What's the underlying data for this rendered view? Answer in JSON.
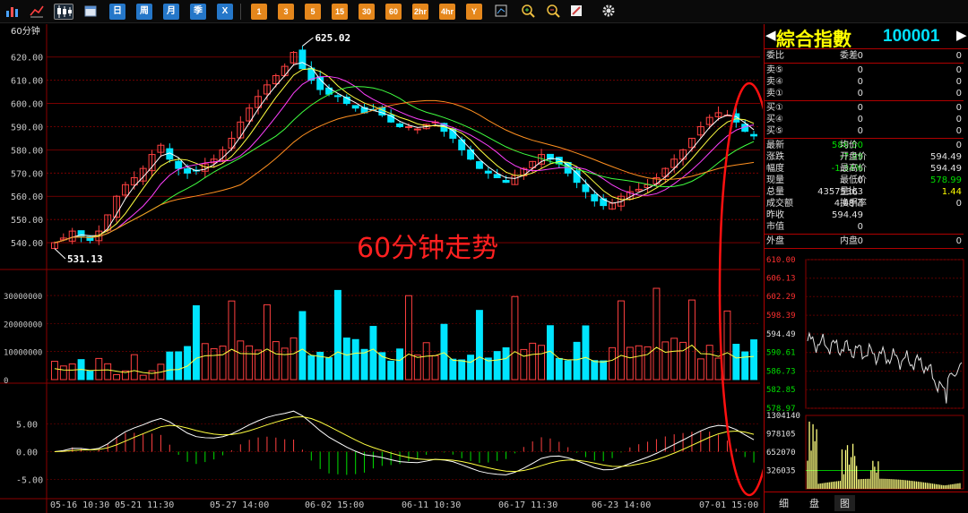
{
  "toolbar": {
    "buttons": [
      "日",
      "周",
      "月",
      "季",
      "X"
    ],
    "periods": [
      "1",
      "3",
      "5",
      "15",
      "30",
      "60",
      "2hr",
      "4hr",
      "Y"
    ]
  },
  "chart": {
    "period_label": "60分钟",
    "overlay_title": "60分钟走势",
    "price_ticks": [
      "620.00",
      "610.00",
      "600.00",
      "590.00",
      "580.00",
      "570.00",
      "560.00",
      "550.00",
      "540.00"
    ],
    "high_label": "625.02",
    "low_label": "531.13",
    "volume_ticks": [
      "30000000",
      "20000000",
      "10000000",
      "0"
    ],
    "macd_ticks": [
      "5.00",
      "0.00",
      "-5.00"
    ],
    "date_labels": [
      "05-16 10:30",
      "05-21 11:30",
      "05-27 14:00",
      "06-02 15:00",
      "06-11 10:30",
      "06-17 11:30",
      "06-23 14:00",
      "07-01 15:00"
    ],
    "colors": {
      "up": "#ff4040",
      "down": "#00e5ff",
      "grid": "#8b0000"
    }
  },
  "chart_data": {
    "type": "candlestick",
    "price_range": [
      530,
      628
    ],
    "close_series": [
      540,
      542,
      545,
      543,
      541,
      545,
      552,
      560,
      565,
      568,
      572,
      578,
      582,
      576,
      572,
      570,
      571,
      574,
      576,
      580,
      585,
      592,
      598,
      603,
      608,
      612,
      616,
      622,
      615,
      610,
      606,
      604,
      603,
      600,
      598,
      596,
      597,
      595,
      592,
      590,
      590,
      589,
      591,
      592,
      588,
      585,
      580,
      576,
      572,
      570,
      568,
      566,
      569,
      572,
      575,
      578,
      576,
      574,
      570,
      566,
      562,
      558,
      556,
      557,
      560,
      562,
      563,
      565,
      568,
      572,
      576,
      580,
      585,
      590,
      594,
      596,
      595,
      592,
      588,
      586
    ]
  },
  "quote": {
    "name": "綜合指數",
    "code": "100001",
    "weibi_label": "委比",
    "weibi_value": "0",
    "weicha_label": "委差",
    "weicha_value": "0",
    "sell": [
      {
        "label": "卖⑤",
        "price": "0",
        "vol": "0"
      },
      {
        "label": "卖④",
        "price": "0",
        "vol": "0"
      },
      {
        "label": "卖①",
        "price": "0",
        "vol": "0"
      }
    ],
    "buy": [
      {
        "label": "买①",
        "price": "0",
        "vol": "0"
      },
      {
        "label": "买④",
        "price": "0",
        "vol": "0"
      },
      {
        "label": "买⑤",
        "price": "0",
        "vol": "0"
      }
    ],
    "stats": [
      {
        "l1": "最新",
        "v1": "586.50",
        "l2": "均价",
        "v2": "0"
      },
      {
        "l1": "涨跌",
        "v1": "-7.99",
        "l2": "开盘价",
        "v2": "594.49"
      },
      {
        "l1": "幅度",
        "v1": "-1.34%",
        "l2": "最高价",
        "v2": "594.49"
      },
      {
        "l1": "现量",
        "v1": "0",
        "l2": "最低价",
        "v2": "578.99"
      },
      {
        "l1": "总量",
        "v1": "43575363",
        "l2": "量比",
        "v2": "1.44"
      },
      {
        "l1": "成交额",
        "v1": "4.68亿",
        "l2": "换手率",
        "v2": "0"
      },
      {
        "l1": "昨收",
        "v1": "594.49",
        "l2": "",
        "v2": ""
      },
      {
        "l1": "市值",
        "v1": "0",
        "l2": "",
        "v2": ""
      }
    ],
    "outer_label": "外盘",
    "outer_value": "0",
    "inner_label": "内盘",
    "inner_value": "0"
  },
  "mini": {
    "price_ticks": [
      "610.00",
      "606.13",
      "602.29",
      "598.39",
      "594.49",
      "590.61",
      "586.73",
      "582.85",
      "578.97"
    ],
    "vol_ticks": [
      "1304140",
      "978105",
      "652070",
      "326035"
    ]
  },
  "bottom_tabs": [
    "细",
    "盘",
    "图"
  ]
}
